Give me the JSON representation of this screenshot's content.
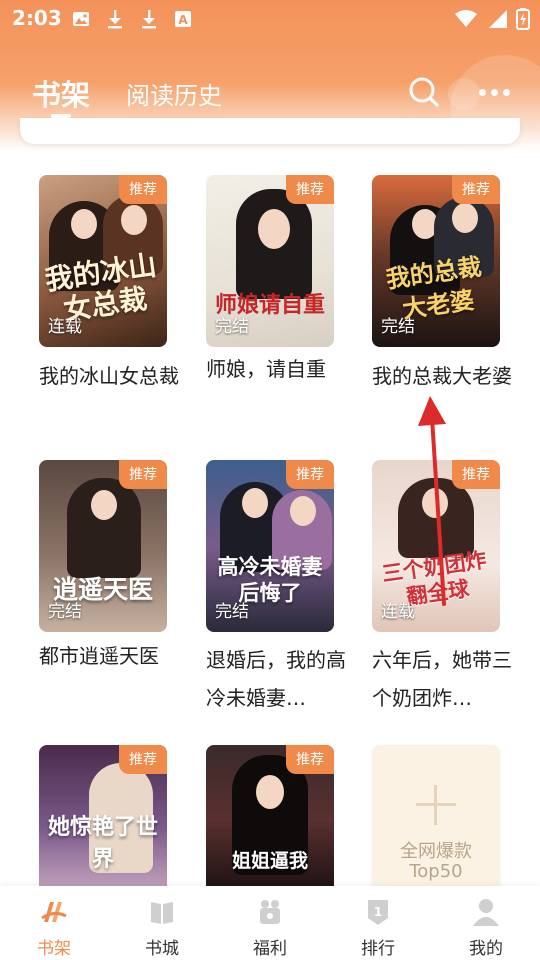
{
  "status_bar": {
    "time": "2:03",
    "icons": [
      "image-icon",
      "download-icon",
      "download-icon",
      "text-a-icon"
    ],
    "right_icons": [
      "wifi-icon",
      "signal-icon",
      "battery-icon"
    ]
  },
  "header": {
    "tabs": [
      {
        "label": "书架",
        "active": true
      },
      {
        "label": "阅读历史",
        "active": false
      }
    ],
    "search_icon": "search-icon",
    "more_icon": "more-icon"
  },
  "colors": {
    "accent": "#f08a4b",
    "header_top": "#f4925a",
    "arrow": "#dd2a2a"
  },
  "books": [
    {
      "title": "我的冰山女总裁",
      "cover_text": "我的冰山女总裁",
      "badge": "推荐",
      "status": "连载"
    },
    {
      "title": "师娘，请自重",
      "cover_text": "师娘请自重",
      "badge": "推荐",
      "status": "完结"
    },
    {
      "title": "我的总裁大老婆",
      "cover_text": "我的总裁大老婆",
      "badge": "推荐",
      "status": "完结"
    },
    {
      "title": "都市逍遥天医",
      "cover_text": "逍遥天医",
      "badge": "推荐",
      "status": "完结"
    },
    {
      "title": "退婚后，我的高冷未婚妻…",
      "cover_text": "高冷未婚妻后悔了",
      "badge": "推荐",
      "status": "完结"
    },
    {
      "title": "六年后，她带三个奶团炸…",
      "cover_text": "三个奶团炸翻全球",
      "badge": "推荐",
      "status": "连载"
    },
    {
      "title": "",
      "cover_text": "她惊艳了世界",
      "badge": "推荐",
      "status": ""
    },
    {
      "title": "",
      "cover_text": "姐姐逼我",
      "badge": "推荐",
      "status": ""
    }
  ],
  "add_card": {
    "line1": "全网爆款",
    "line2": "Top50"
  },
  "bottom_nav": [
    {
      "label": "书架",
      "icon": "bookshelf-icon",
      "active": true
    },
    {
      "label": "书城",
      "icon": "book-icon",
      "active": false
    },
    {
      "label": "福利",
      "icon": "gift-icon",
      "active": false
    },
    {
      "label": "排行",
      "icon": "rank-icon",
      "active": false
    },
    {
      "label": "我的",
      "icon": "user-icon",
      "active": false
    }
  ]
}
